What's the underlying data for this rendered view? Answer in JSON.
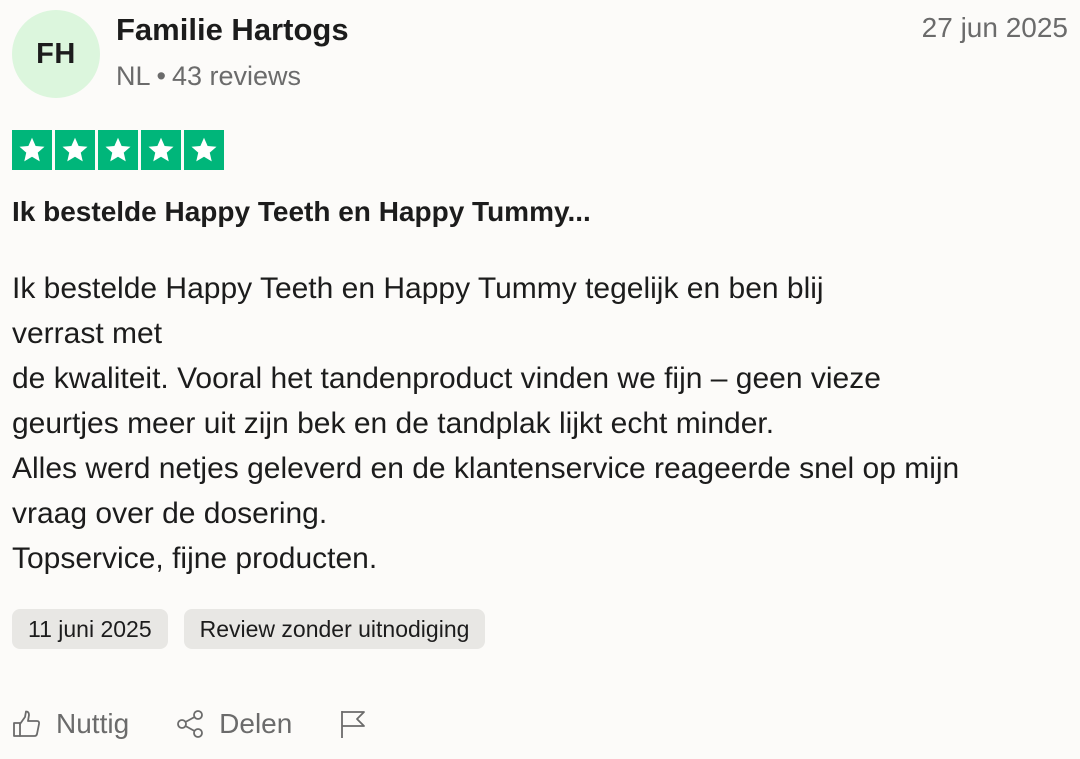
{
  "reviewer": {
    "initials": "FH",
    "name": "Familie Hartogs",
    "country": "NL",
    "separator": "•",
    "review_count": "43 reviews",
    "avatar_color": "#dcf6dd"
  },
  "review": {
    "date": "27 jun 2025",
    "rating": 5,
    "rating_max": 5,
    "star_color": "#00b67a",
    "title": "Ik bestelde Happy Teeth en Happy Tummy...",
    "body_lines": [
      "Ik bestelde Happy Teeth en Happy Tummy tegelijk en ben blij",
      "verrast met",
      "de kwaliteit. Vooral het tandenproduct vinden we fijn – geen vieze",
      "geurtjes meer uit zijn bek en de tandplak lijkt echt minder.",
      "Alles werd netjes geleverd en de klantenservice reageerde snel op mijn",
      "vraag over de dosering.",
      "Topservice, fijne producten."
    ],
    "experience_date": "11 juni 2025",
    "label": "Review zonder uitnodiging"
  },
  "actions": {
    "useful_label": "Nuttig",
    "useful_icon": "thumbs-up-icon",
    "share_label": "Delen",
    "share_icon": "share-icon",
    "report_icon": "flag-icon"
  }
}
